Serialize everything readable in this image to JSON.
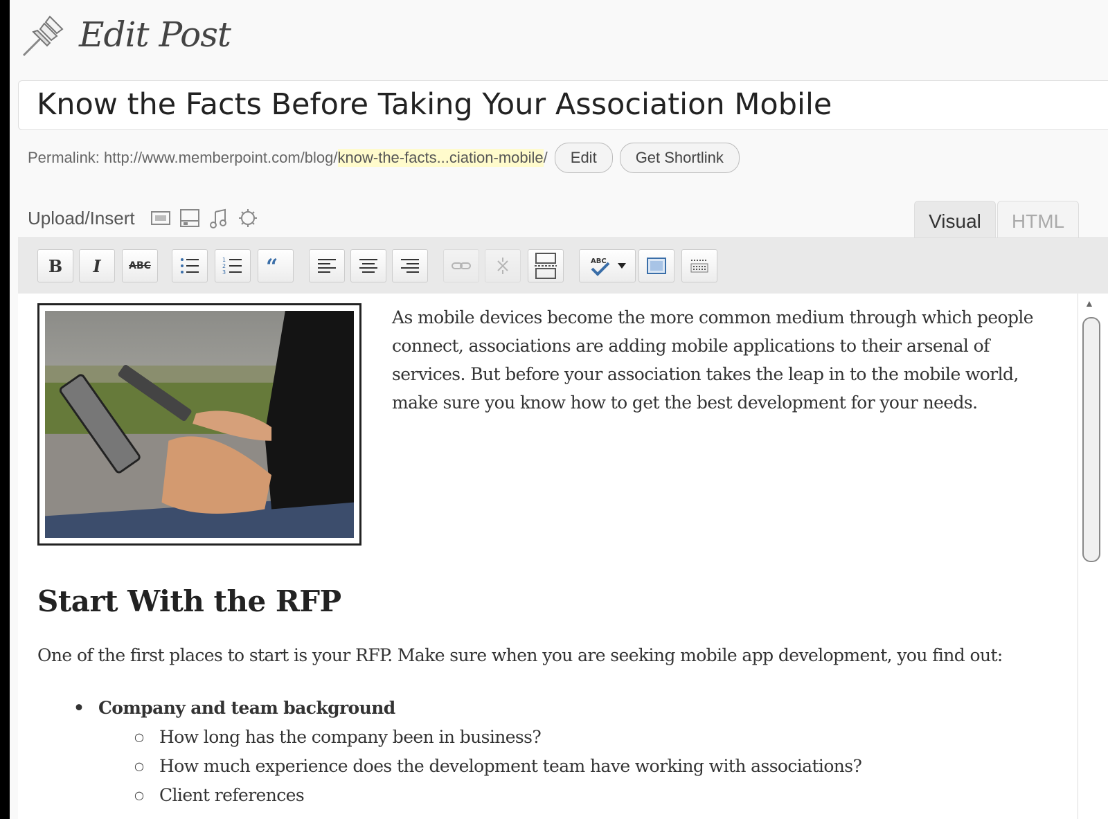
{
  "header": {
    "title": "Edit Post",
    "icon": "pushpin-icon"
  },
  "post": {
    "title": "Know the Facts Before Taking Your Association Mobile"
  },
  "permalink": {
    "label": "Permalink: http://www.memberpoint.com/blog/",
    "slug": "know-the-facts...ciation-mobile",
    "suffix": "/",
    "edit_button": "Edit",
    "shortlink_button": "Get Shortlink"
  },
  "upload": {
    "label": "Upload/Insert",
    "icons": [
      "image-icon",
      "video-icon",
      "audio-icon",
      "media-icon"
    ]
  },
  "tabs": {
    "visual": "Visual",
    "html": "HTML",
    "active": "Visual"
  },
  "toolbar": {
    "buttons": [
      "bold",
      "italic",
      "strikethrough",
      "bullet-list",
      "numbered-list",
      "blockquote",
      "align-left",
      "align-center",
      "align-right",
      "insert-link",
      "unlink",
      "insert-more",
      "spellcheck",
      "fullscreen",
      "kitchen-sink"
    ],
    "bold_label": "B",
    "italic_label": "I",
    "strike_label": "ABC"
  },
  "content": {
    "intro": "As mobile devices become the more common medium through which people connect, associations are adding mobile applications to their arsenal of services. But before your association takes the leap in to the mobile world, make sure you know how to get the best development for your needs.",
    "heading": "Start With the RFP",
    "paragraph": "One of the first places to start is your RFP. Make sure when you are seeking mobile app development, you find out:",
    "list": [
      {
        "text": "Company and team background",
        "subitems": [
          "How long has the company been in business?",
          "How much experience does the development team have working with associations?",
          "Client references"
        ]
      }
    ]
  }
}
